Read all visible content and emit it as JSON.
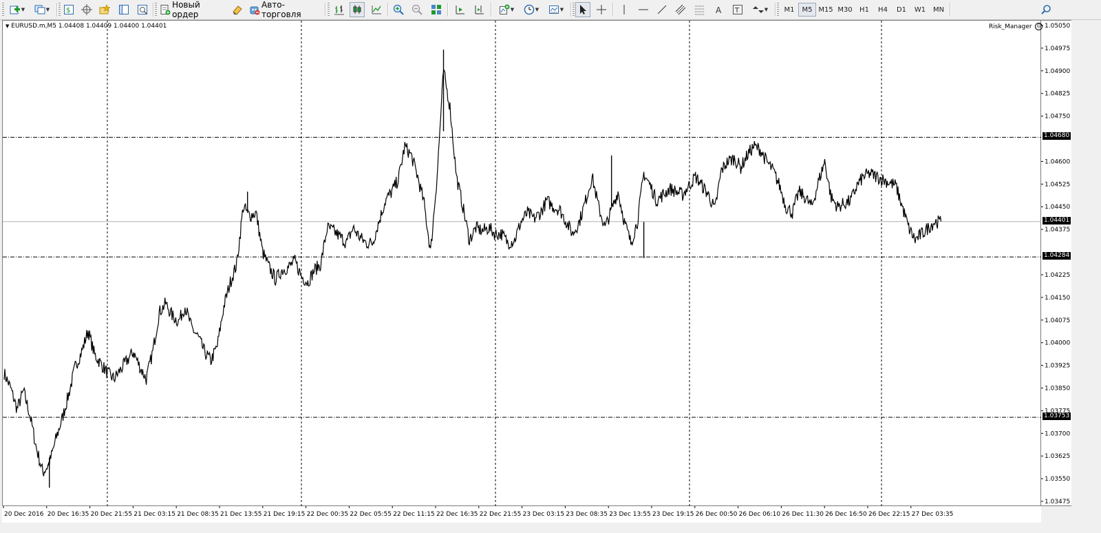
{
  "toolbar": {
    "new_order_label": "Новый ордер",
    "autotrading_label": "Авто-торговля",
    "timeframes": [
      "M1",
      "M5",
      "M15",
      "M30",
      "H1",
      "H4",
      "D1",
      "W1",
      "MN"
    ],
    "active_timeframe": "M5",
    "icons": [
      "new-chart-icon",
      "profiles-icon",
      "market-watch-icon",
      "navigator-crosshair-icon",
      "favorites-icon",
      "terminal-icon",
      "strategy-tester-icon",
      "new-order-icon",
      "metaeditor-icon",
      "autotrading-icon",
      "bar-chart-icon",
      "candlestick-icon",
      "line-chart-icon",
      "zoom-in-icon",
      "zoom-out-icon",
      "tile-windows-icon",
      "chart-shift-icon",
      "autoscroll-icon",
      "indicators-icon",
      "periods-icon",
      "templates-icon",
      "cursor-icon",
      "crosshair-icon",
      "vertical-line-icon",
      "horizontal-line-icon",
      "trendline-icon",
      "equidistant-channel-icon",
      "fibonacci-icon",
      "text-icon",
      "text-label-icon",
      "arrows-icon",
      "search-icon"
    ]
  },
  "chart": {
    "symbol_line": "EURUSD.m,M5  1.04408 1.04409 1.04400 1.04401",
    "expert_name": "Risk_Manager",
    "expert_smile": "☹",
    "current_price_tag": "1.04401",
    "level_tags": [
      "1.04680",
      "1.04284",
      "1.03753"
    ],
    "colors": {
      "background": "#ffffff",
      "line": "#000000",
      "grid": "#000000",
      "tag_bg": "#000000",
      "tag_fg": "#ffffff"
    }
  },
  "chart_data": {
    "type": "line",
    "title": "",
    "series_name": "",
    "y_ticks": [
      "1.05050",
      "1.04975",
      "1.04900",
      "1.04825",
      "1.04750",
      "1.04600",
      "1.04525",
      "1.04450",
      "1.04375",
      "1.04225",
      "1.04150",
      "1.04075",
      "1.04000",
      "1.03925",
      "1.03850",
      "1.03775",
      "1.03700",
      "1.03625",
      "1.03550",
      "1.03475"
    ],
    "ylim": [
      1.03475,
      1.0505
    ],
    "x_ticks": [
      "20 Dec 2016",
      "20 Dec 16:35",
      "20 Dec 21:55",
      "21 Dec 03:15",
      "21 Dec 08:35",
      "21 Dec 13:55",
      "21 Dec 19:15",
      "22 Dec 00:35",
      "22 Dec 05:55",
      "22 Dec 11:15",
      "22 Dec 16:35",
      "22 Dec 21:55",
      "23 Dec 03:15",
      "23 Dec 08:35",
      "23 Dec 13:55",
      "23 Dec 19:15",
      "26 Dec 00:50",
      "26 Dec 06:10",
      "26 Dec 11:30",
      "26 Dec 16:50",
      "26 Dec 22:15",
      "27 Dec 03:35"
    ],
    "horizontal_levels": [
      1.0468,
      1.04284,
      1.03753
    ],
    "current_price": 1.04401,
    "grid": "vertical dashed separators",
    "price_path": [
      [
        0,
        1.039
      ],
      [
        0.3,
        1.0385
      ],
      [
        0.6,
        1.0378
      ],
      [
        0.9,
        1.0384
      ],
      [
        1.2,
        1.0376
      ],
      [
        1.5,
        1.0365
      ],
      [
        1.8,
        1.0357
      ],
      [
        2.1,
        1.036
      ],
      [
        2.4,
        1.0368
      ],
      [
        2.7,
        1.0375
      ],
      [
        3.0,
        1.0383
      ],
      [
        3.3,
        1.0392
      ],
      [
        3.6,
        1.0397
      ],
      [
        3.9,
        1.0404
      ],
      [
        4.2,
        1.0396
      ],
      [
        4.5,
        1.0393
      ],
      [
        4.8,
        1.039
      ],
      [
        5.1,
        1.0388
      ],
      [
        5.4,
        1.0391
      ],
      [
        5.7,
        1.0394
      ],
      [
        6.0,
        1.0397
      ],
      [
        6.3,
        1.0392
      ],
      [
        6.6,
        1.0388
      ],
      [
        6.9,
        1.0397
      ],
      [
        7.2,
        1.041
      ],
      [
        7.5,
        1.0413
      ],
      [
        7.8,
        1.0409
      ],
      [
        8.1,
        1.0407
      ],
      [
        8.4,
        1.0412
      ],
      [
        8.7,
        1.0405
      ],
      [
        9.0,
        1.0402
      ],
      [
        9.3,
        1.0397
      ],
      [
        9.6,
        1.0394
      ],
      [
        9.9,
        1.0399
      ],
      [
        10.2,
        1.0412
      ],
      [
        10.5,
        1.042
      ],
      [
        10.8,
        1.0426
      ],
      [
        11.1,
        1.0445
      ],
      [
        11.4,
        1.0442
      ],
      [
        11.7,
        1.0443
      ],
      [
        12.0,
        1.043
      ],
      [
        12.3,
        1.0425
      ],
      [
        12.6,
        1.0421
      ],
      [
        12.9,
        1.0424
      ],
      [
        13.2,
        1.0425
      ],
      [
        13.5,
        1.0427
      ],
      [
        13.8,
        1.0422
      ],
      [
        14.1,
        1.042
      ],
      [
        14.4,
        1.0424
      ],
      [
        14.7,
        1.0426
      ],
      [
        15.0,
        1.0438
      ],
      [
        15.3,
        1.0437
      ],
      [
        15.6,
        1.0435
      ],
      [
        15.9,
        1.0433
      ],
      [
        16.2,
        1.0438
      ],
      [
        16.5,
        1.0435
      ],
      [
        16.8,
        1.0433
      ],
      [
        17.1,
        1.0433
      ],
      [
        17.4,
        1.044
      ],
      [
        17.7,
        1.0447
      ],
      [
        18.0,
        1.045
      ],
      [
        18.3,
        1.0454
      ],
      [
        18.6,
        1.0465
      ],
      [
        18.9,
        1.0462
      ],
      [
        19.2,
        1.0455
      ],
      [
        19.5,
        1.0446
      ],
      [
        19.8,
        1.043
      ],
      [
        20.1,
        1.0455
      ],
      [
        20.4,
        1.049
      ],
      [
        20.7,
        1.0478
      ],
      [
        21.0,
        1.0455
      ],
      [
        21.3,
        1.0445
      ],
      [
        21.6,
        1.0434
      ],
      [
        21.9,
        1.0438
      ],
      [
        22.2,
        1.0437
      ],
      [
        22.5,
        1.0438
      ],
      [
        22.8,
        1.0436
      ],
      [
        23.1,
        1.0436
      ],
      [
        23.4,
        1.0433
      ],
      [
        23.7,
        1.0434
      ],
      [
        24.0,
        1.044
      ],
      [
        24.3,
        1.0443
      ],
      [
        24.6,
        1.0441
      ],
      [
        24.9,
        1.0443
      ],
      [
        25.2,
        1.0447
      ],
      [
        25.5,
        1.0445
      ],
      [
        25.8,
        1.0444
      ],
      [
        26.1,
        1.044
      ],
      [
        26.4,
        1.0436
      ],
      [
        26.7,
        1.044
      ],
      [
        27.0,
        1.0447
      ],
      [
        27.3,
        1.0455
      ],
      [
        27.6,
        1.0445
      ],
      [
        27.9,
        1.0438
      ],
      [
        28.2,
        1.0444
      ],
      [
        28.5,
        1.045
      ],
      [
        28.8,
        1.044
      ],
      [
        29.1,
        1.0433
      ],
      [
        29.4,
        1.044
      ],
      [
        29.7,
        1.0456
      ],
      [
        30.0,
        1.0452
      ],
      [
        30.3,
        1.0447
      ],
      [
        30.6,
        1.0449
      ],
      [
        30.9,
        1.0451
      ],
      [
        31.2,
        1.045
      ],
      [
        31.5,
        1.0449
      ],
      [
        31.8,
        1.0452
      ],
      [
        32.1,
        1.0455
      ],
      [
        32.4,
        1.0452
      ],
      [
        32.7,
        1.0449
      ],
      [
        33.0,
        1.0444
      ],
      [
        33.3,
        1.0457
      ],
      [
        33.6,
        1.046
      ],
      [
        33.9,
        1.0461
      ],
      [
        34.2,
        1.0458
      ],
      [
        34.5,
        1.0462
      ],
      [
        34.8,
        1.0465
      ],
      [
        35.1,
        1.0464
      ],
      [
        35.4,
        1.046
      ],
      [
        35.7,
        1.0457
      ],
      [
        36.0,
        1.0452
      ],
      [
        36.3,
        1.0445
      ],
      [
        36.6,
        1.0443
      ],
      [
        36.9,
        1.045
      ],
      [
        37.2,
        1.0448
      ],
      [
        37.5,
        1.0445
      ],
      [
        37.8,
        1.0453
      ],
      [
        38.1,
        1.046
      ],
      [
        38.4,
        1.0448
      ],
      [
        38.7,
        1.0445
      ],
      [
        39.0,
        1.0446
      ],
      [
        39.3,
        1.0447
      ],
      [
        39.6,
        1.0452
      ],
      [
        39.9,
        1.0455
      ],
      [
        40.2,
        1.0456
      ],
      [
        40.5,
        1.0455
      ],
      [
        40.8,
        1.0454
      ],
      [
        41.1,
        1.0453
      ],
      [
        41.4,
        1.0452
      ],
      [
        41.7,
        1.0445
      ],
      [
        42.0,
        1.0438
      ],
      [
        42.3,
        1.0434
      ],
      [
        42.6,
        1.0436
      ],
      [
        42.9,
        1.0438
      ],
      [
        43.2,
        1.044
      ],
      [
        43.5,
        1.044
      ]
    ]
  }
}
